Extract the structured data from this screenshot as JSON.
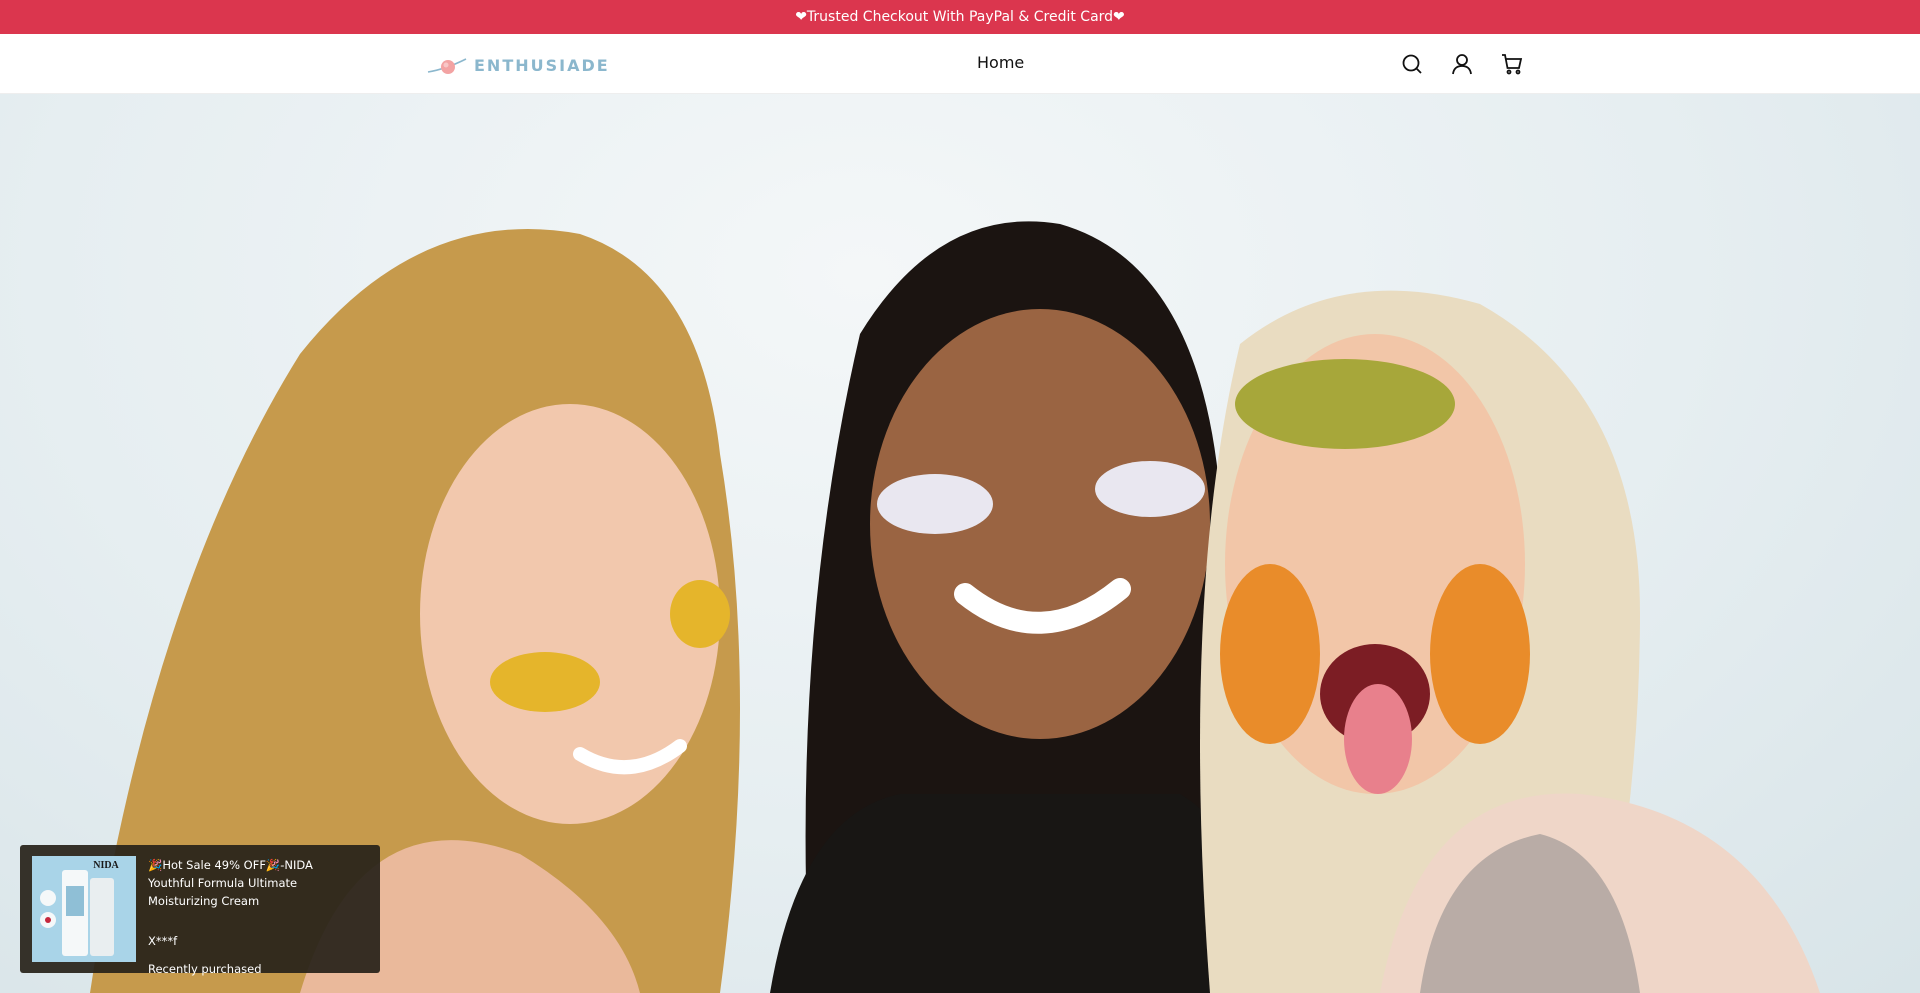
{
  "announcement": {
    "text": "❤Trusted Checkout With PayPal & Credit Card❤"
  },
  "header": {
    "logo_text": "ENTHUSIADE",
    "nav": [
      {
        "label": "Home"
      }
    ],
    "icons": [
      "search-icon",
      "account-icon",
      "cart-icon"
    ]
  },
  "hero": {
    "image_description": "hero-photo"
  },
  "popup": {
    "title": "🎉Hot Sale 49% OFF🎉-NIDA Youthful Formula Ultimate Moisturizing Cream",
    "buyer": "X***f",
    "status": "Recently purchased",
    "thumb_brand": "NIDA"
  },
  "colors": {
    "announcement_bg": "#db364e",
    "logo": "#8bb7cd",
    "text": "#111111"
  }
}
